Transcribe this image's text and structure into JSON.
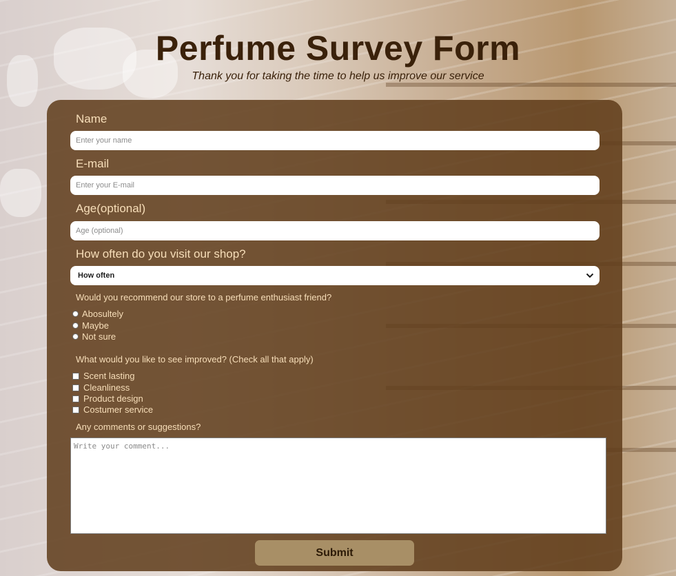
{
  "header": {
    "title": "Perfume Survey Form",
    "subtitle": "Thank you for taking the time to help us improve our service"
  },
  "form": {
    "name": {
      "label": "Name",
      "placeholder": "Enter your name",
      "value": ""
    },
    "email": {
      "label": "E-mail",
      "placeholder": "Enter your E-mail",
      "value": ""
    },
    "age": {
      "label": "Age(optional)",
      "placeholder": "Age (optional)",
      "value": ""
    },
    "visit": {
      "label": "How often do you visit our shop?",
      "selected": "How often"
    },
    "recommend": {
      "question": "Would you recommend our store to a perfume enthusiast friend?",
      "options": [
        "Abosultely",
        "Maybe",
        "Not sure"
      ]
    },
    "improve": {
      "question": "What would you like to see improved? (Check all that apply)",
      "options": [
        "Scent lasting",
        "Cleanliness",
        "Product design",
        "Costumer service"
      ]
    },
    "comments": {
      "label": "Any comments or suggestions?",
      "placeholder": "Write your comment..."
    },
    "submit_label": "Submit"
  },
  "colors": {
    "title": "#3a210a",
    "card": "#603c1b",
    "label": "#f7deb9",
    "submit": "#a88f66"
  },
  "icons": {
    "select_arrow": "chevron-down-icon"
  }
}
